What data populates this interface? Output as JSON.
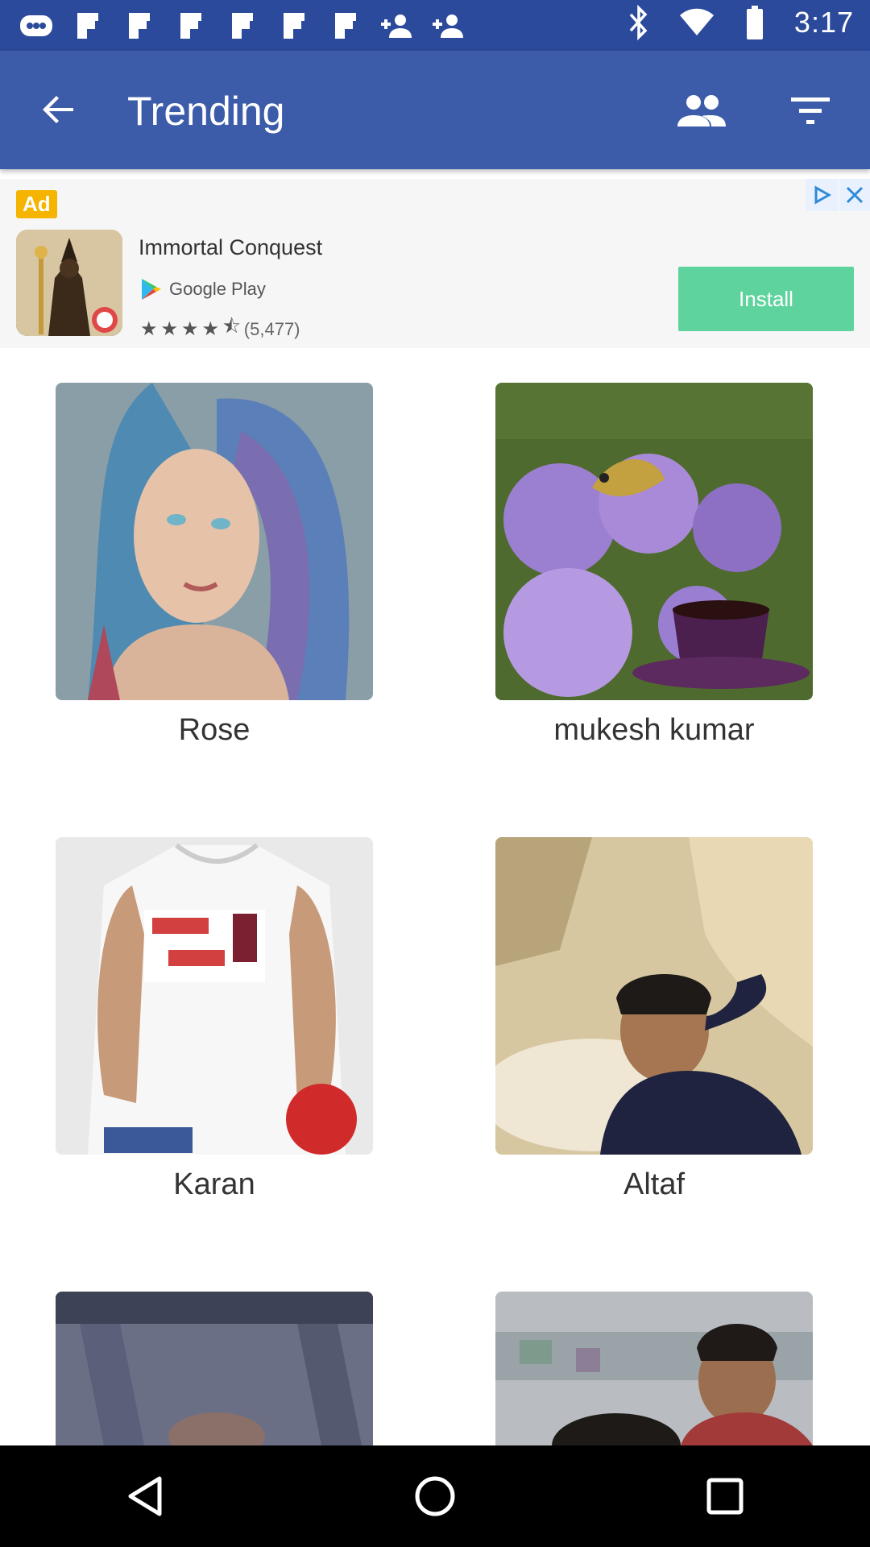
{
  "status_bar": {
    "time": "3:17",
    "left_icons": [
      "discord-icon",
      "flipboard-icon",
      "flipboard-icon",
      "flipboard-icon",
      "flipboard-icon",
      "flipboard-icon",
      "flipboard-icon",
      "person-add-icon",
      "person-add-icon"
    ],
    "right_icons": [
      "bluetooth-icon",
      "wifi-icon",
      "battery-icon"
    ]
  },
  "app_bar": {
    "title": "Trending",
    "icons": [
      "back-arrow-icon",
      "people-icon",
      "filter-icon"
    ]
  },
  "ad": {
    "badge": "Ad",
    "app_name": "Immortal Conquest",
    "store": "Google Play",
    "rating_count": "(5,477)",
    "stars": 4.5,
    "install_label": "Install"
  },
  "users": [
    {
      "name": "Rose"
    },
    {
      "name": "mukesh kumar"
    },
    {
      "name": "Karan"
    },
    {
      "name": "Altaf"
    },
    {
      "name": ""
    },
    {
      "name": ""
    }
  ],
  "colors": {
    "status_bar": "#2c4a9c",
    "app_bar": "#3c5ba9",
    "install": "#5fd39d",
    "ad_badge": "#f4b400"
  },
  "nav": {
    "icons": [
      "back-triangle-icon",
      "home-circle-icon",
      "recents-square-icon"
    ]
  }
}
